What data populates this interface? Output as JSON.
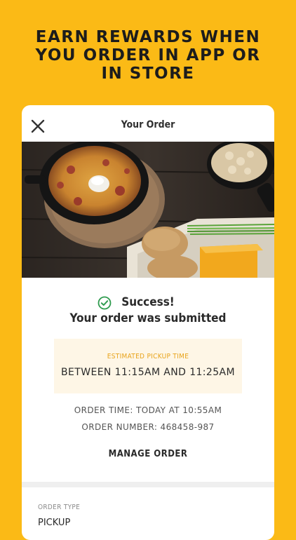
{
  "headline": {
    "line1": "EARN REWARDS WHEN",
    "line2": "YOU ORDER IN APP OR",
    "line3": "IN STORE"
  },
  "header": {
    "title": "Your Order",
    "close_icon": "close-icon"
  },
  "status": {
    "icon": "check-circle-icon",
    "title": "Success!",
    "message": "Your order was submitted"
  },
  "pickup": {
    "label": "ESTIMATED PICKUP TIME",
    "time": "BETWEEN 11:15AM AND 11:25AM"
  },
  "order": {
    "time": "ORDER TIME: TODAY AT 10:55AM",
    "number": "ORDER NUMBER: 468458-987"
  },
  "actions": {
    "manage": "MANAGE ORDER"
  },
  "details": {
    "order_type_label": "ORDER TYPE",
    "order_type_value": "PICKUP"
  },
  "colors": {
    "background": "#FBBA16",
    "accent": "#E8A31A",
    "success": "#2E9B4E"
  }
}
